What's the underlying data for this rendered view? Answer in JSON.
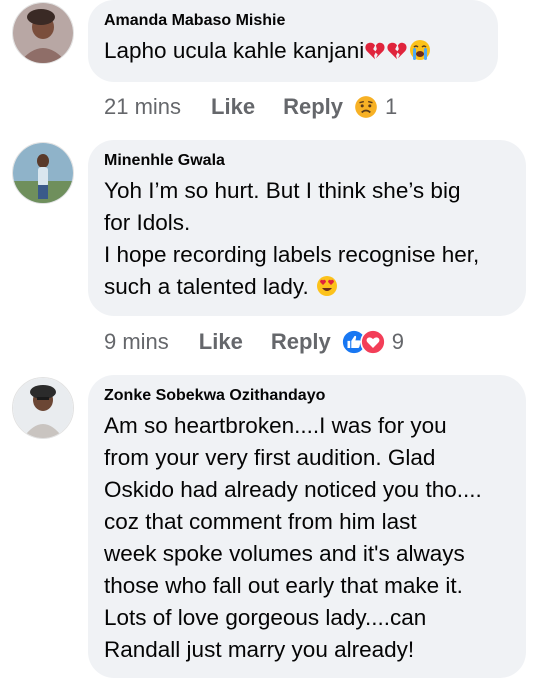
{
  "comments": [
    {
      "author": "Amanda Mabaso Mishie",
      "text_lines": [
        "Lapho ucula kahle kanjani"
      ],
      "emojis": [
        "broken-heart",
        "broken-heart",
        "loudly-crying-face"
      ],
      "time": "21 mins",
      "like_label": "Like",
      "reply_label": "Reply",
      "reactions": [
        "sad"
      ],
      "reaction_count": "1"
    },
    {
      "author": "Minenhle Gwala",
      "text_lines": [
        "Yoh I’m so hurt. But I think she’s big",
        "for Idols.",
        "I hope recording labels recognise her,",
        "such a talented lady."
      ],
      "emojis": [
        "heart-eyes-face"
      ],
      "time": "9 mins",
      "like_label": "Like",
      "reply_label": "Reply",
      "reactions": [
        "like",
        "love"
      ],
      "reaction_count": "9"
    },
    {
      "author": "Zonke Sobekwa Ozithandayo",
      "text_lines": [
        "Am so heartbroken....I was for you",
        "from your very first audition. Glad",
        "Oskido had already noticed you tho....",
        "coz that comment from him last",
        "week spoke volumes and it's always",
        "those who fall out early that make it.",
        "Lots of love gorgeous lady....can",
        "Randall just marry you already!"
      ]
    }
  ],
  "colors": {
    "bubble": "#f0f2f5",
    "text": "#050505",
    "meta": "#65676b",
    "like_blue": "#1877f2",
    "love_red": "#f33e58"
  }
}
